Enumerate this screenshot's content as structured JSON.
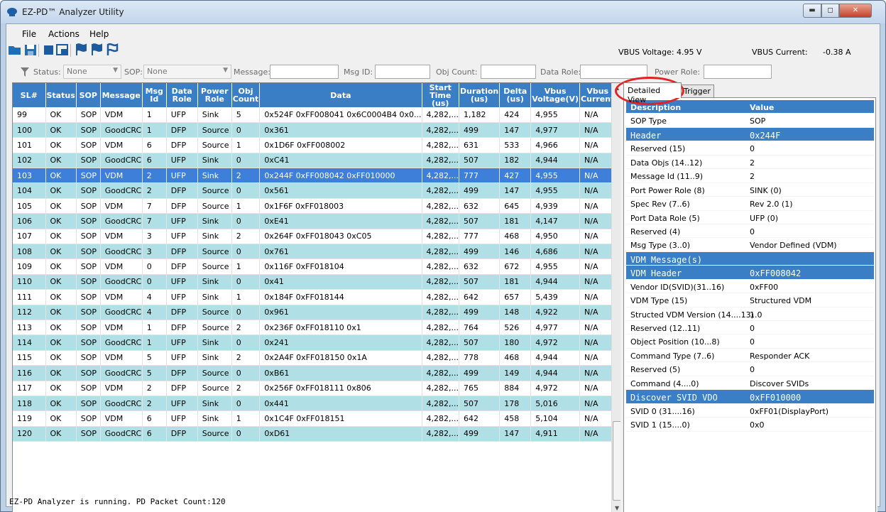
{
  "window": {
    "title": "EZ-PD™ Analyzer Utility"
  },
  "menu": [
    "File",
    "Actions",
    "Help"
  ],
  "toolbar": {
    "icons": [
      "open-folder-icon",
      "save-icon",
      "stop-icon",
      "database-icon",
      "flag-icon",
      "flag-icon",
      "flag-outline-icon"
    ]
  },
  "vbus": {
    "voltage_label": "VBUS Voltage:",
    "voltage_value": "4.95 V",
    "current_label": "VBUS Current:",
    "current_value": "-0.38 A"
  },
  "filters": {
    "status_label": "Status:",
    "status_value": "None",
    "sop_label": "SOP:",
    "sop_value": "None",
    "message_label": "Message:",
    "msgid_label": "Msg ID:",
    "objcount_label": "Obj Count:",
    "datarole_label": "Data Role:",
    "powerrole_label": "Power Role:"
  },
  "grid": {
    "columns": [
      "SL#",
      "Status",
      "SOP",
      "Message",
      "Msg Id",
      "Data Role",
      "Power Role",
      "Obj Count",
      "Data",
      "Start Time (us)",
      "Duration (us)",
      "Delta (us)",
      "Vbus Voltage(V)",
      "Vbus Current"
    ],
    "rows": [
      [
        "99",
        "OK",
        "SOP",
        "VDM",
        "1",
        "UFP",
        "Sink",
        "5",
        "0x524F 0xFF008041 0x6C0004B4 0x0...",
        "4,282,...",
        "1,182",
        "424",
        "4,955",
        "N/A"
      ],
      [
        "100",
        "OK",
        "SOP",
        "GoodCRC",
        "1",
        "DFP",
        "Source",
        "0",
        "0x361",
        "4,282,...",
        "499",
        "147",
        "4,977",
        "N/A"
      ],
      [
        "101",
        "OK",
        "SOP",
        "VDM",
        "6",
        "DFP",
        "Source",
        "1",
        "0x1D6F 0xFF008002",
        "4,282,...",
        "631",
        "533",
        "4,966",
        "N/A"
      ],
      [
        "102",
        "OK",
        "SOP",
        "GoodCRC",
        "6",
        "UFP",
        "Sink",
        "0",
        "0xC41",
        "4,282,...",
        "507",
        "182",
        "4,944",
        "N/A"
      ],
      [
        "103",
        "OK",
        "SOP",
        "VDM",
        "2",
        "UFP",
        "Sink",
        "2",
        "0x244F 0xFF008042 0xFF010000",
        "4,282,...",
        "777",
        "427",
        "4,955",
        "N/A"
      ],
      [
        "104",
        "OK",
        "SOP",
        "GoodCRC",
        "2",
        "DFP",
        "Source",
        "0",
        "0x561",
        "4,282,...",
        "499",
        "147",
        "4,955",
        "N/A"
      ],
      [
        "105",
        "OK",
        "SOP",
        "VDM",
        "7",
        "DFP",
        "Source",
        "1",
        "0x1F6F 0xFF018003",
        "4,282,...",
        "632",
        "645",
        "4,939",
        "N/A"
      ],
      [
        "106",
        "OK",
        "SOP",
        "GoodCRC",
        "7",
        "UFP",
        "Sink",
        "0",
        "0xE41",
        "4,282,...",
        "507",
        "181",
        "4,147",
        "N/A"
      ],
      [
        "107",
        "OK",
        "SOP",
        "VDM",
        "3",
        "UFP",
        "Sink",
        "2",
        "0x264F 0xFF018043 0xC05",
        "4,282,...",
        "777",
        "468",
        "4,950",
        "N/A"
      ],
      [
        "108",
        "OK",
        "SOP",
        "GoodCRC",
        "3",
        "DFP",
        "Source",
        "0",
        "0x761",
        "4,282,...",
        "499",
        "146",
        "4,686",
        "N/A"
      ],
      [
        "109",
        "OK",
        "SOP",
        "VDM",
        "0",
        "DFP",
        "Source",
        "1",
        "0x116F 0xFF018104",
        "4,282,...",
        "632",
        "672",
        "4,955",
        "N/A"
      ],
      [
        "110",
        "OK",
        "SOP",
        "GoodCRC",
        "0",
        "UFP",
        "Sink",
        "0",
        "0x41",
        "4,282,...",
        "507",
        "181",
        "4,944",
        "N/A"
      ],
      [
        "111",
        "OK",
        "SOP",
        "VDM",
        "4",
        "UFP",
        "Sink",
        "1",
        "0x184F 0xFF018144",
        "4,282,...",
        "642",
        "657",
        "5,439",
        "N/A"
      ],
      [
        "112",
        "OK",
        "SOP",
        "GoodCRC",
        "4",
        "DFP",
        "Source",
        "0",
        "0x961",
        "4,282,...",
        "499",
        "148",
        "4,922",
        "N/A"
      ],
      [
        "113",
        "OK",
        "SOP",
        "VDM",
        "1",
        "DFP",
        "Source",
        "2",
        "0x236F 0xFF018110 0x1",
        "4,282,...",
        "764",
        "526",
        "4,977",
        "N/A"
      ],
      [
        "114",
        "OK",
        "SOP",
        "GoodCRC",
        "1",
        "UFP",
        "Sink",
        "0",
        "0x241",
        "4,282,...",
        "507",
        "180",
        "4,972",
        "N/A"
      ],
      [
        "115",
        "OK",
        "SOP",
        "VDM",
        "5",
        "UFP",
        "Sink",
        "2",
        "0x2A4F 0xFF018150 0x1A",
        "4,282,...",
        "778",
        "468",
        "4,944",
        "N/A"
      ],
      [
        "116",
        "OK",
        "SOP",
        "GoodCRC",
        "5",
        "DFP",
        "Source",
        "0",
        "0xB61",
        "4,282,...",
        "499",
        "149",
        "4,944",
        "N/A"
      ],
      [
        "117",
        "OK",
        "SOP",
        "VDM",
        "2",
        "DFP",
        "Source",
        "2",
        "0x256F 0xFF018111 0x806",
        "4,282,...",
        "765",
        "884",
        "4,972",
        "N/A"
      ],
      [
        "118",
        "OK",
        "SOP",
        "GoodCRC",
        "2",
        "UFP",
        "Sink",
        "0",
        "0x441",
        "4,282,...",
        "507",
        "178",
        "5,016",
        "N/A"
      ],
      [
        "119",
        "OK",
        "SOP",
        "VDM",
        "6",
        "UFP",
        "Sink",
        "1",
        "0x1C4F 0xFF018151",
        "4,282,...",
        "642",
        "458",
        "5,104",
        "N/A"
      ],
      [
        "120",
        "OK",
        "SOP",
        "GoodCRC",
        "6",
        "DFP",
        "Source",
        "0",
        "0xD61",
        "4,282,...",
        "499",
        "147",
        "4,911",
        "N/A"
      ]
    ],
    "selected_sl": "103"
  },
  "tabs": {
    "detailed": "Detailed View",
    "trigger": "Trigger"
  },
  "detail": [
    {
      "type": "header",
      "k": "Description",
      "v": "Value"
    },
    {
      "type": "row",
      "k": "SOP Type",
      "v": "SOP"
    },
    {
      "type": "section",
      "k": "Header",
      "v": "0x244F"
    },
    {
      "type": "row",
      "k": "Reserved (15)",
      "v": "0"
    },
    {
      "type": "row",
      "k": "Data Objs (14..12)",
      "v": "2"
    },
    {
      "type": "row",
      "k": "Message Id (11..9)",
      "v": "2"
    },
    {
      "type": "row",
      "k": "Port Power Role (8)",
      "v": "SINK (0)"
    },
    {
      "type": "row",
      "k": "Spec Rev (7..6)",
      "v": "Rev 2.0 (1)"
    },
    {
      "type": "row",
      "k": "Port Data Role (5)",
      "v": "UFP (0)"
    },
    {
      "type": "row",
      "k": "Reserved (4)",
      "v": "0"
    },
    {
      "type": "row",
      "k": "Msg Type (3..0)",
      "v": "Vendor Defined (VDM)"
    },
    {
      "type": "section",
      "k": "VDM Message(s)",
      "v": ""
    },
    {
      "type": "section",
      "k": "VDM Header",
      "v": "0xFF008042"
    },
    {
      "type": "row",
      "k": "Vendor ID(SVID)(31..16)",
      "v": "0xFF00"
    },
    {
      "type": "row",
      "k": "VDM Type (15)",
      "v": "Structured VDM"
    },
    {
      "type": "row",
      "k": "Structed VDM Version (14....13)",
      "v": "1.0"
    },
    {
      "type": "row",
      "k": "Reserved (12..11)",
      "v": "0"
    },
    {
      "type": "row",
      "k": "Object Position (10...8)",
      "v": "0"
    },
    {
      "type": "row",
      "k": "Command Type (7..6)",
      "v": "Responder ACK"
    },
    {
      "type": "row",
      "k": "Reserved (5)",
      "v": "0"
    },
    {
      "type": "row",
      "k": "Command (4....0)",
      "v": "Discover SVIDs"
    },
    {
      "type": "section",
      "k": "Discover SVID VDO",
      "v": "0xFF010000"
    },
    {
      "type": "row",
      "k": "SVID 0 (31....16)",
      "v": "0xFF01(DisplayPort)"
    },
    {
      "type": "row",
      "k": "SVID 1 (15....0)",
      "v": "0x0"
    }
  ],
  "statusbar": {
    "text": "EZ-PD Analyzer is running. PD Packet Count:120"
  },
  "colors": {
    "header_blue": "#3a7fc6",
    "row_alt": "#b0e0e6",
    "selected": "#3d7fd9",
    "annotation_red": "#e32222"
  }
}
